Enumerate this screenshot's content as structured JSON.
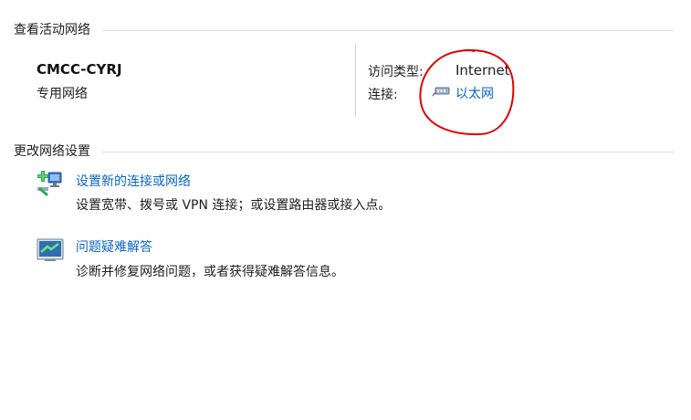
{
  "active_networks": {
    "title": "查看活动网络",
    "network_name": "CMCC-CYRJ",
    "network_profile": "专用网络",
    "access_type_label": "访问类型:",
    "access_type_value": "Internet",
    "connections_label": "连接:",
    "connection_link": "以太网"
  },
  "change_settings": {
    "title": "更改网络设置",
    "actions": [
      {
        "icon": "network-add-icon",
        "link": "设置新的连接或网络",
        "description": "设置宽带、拨号或 VPN 连接；或设置路由器或接入点。"
      },
      {
        "icon": "troubleshoot-icon",
        "link": "问题疑难解答",
        "description": "诊断并修复网络问题，或者获得疑难解答信息。"
      }
    ]
  },
  "colors": {
    "link": "#0a66c2",
    "annotation": "#e00000",
    "separator": "#dcdcdc"
  }
}
